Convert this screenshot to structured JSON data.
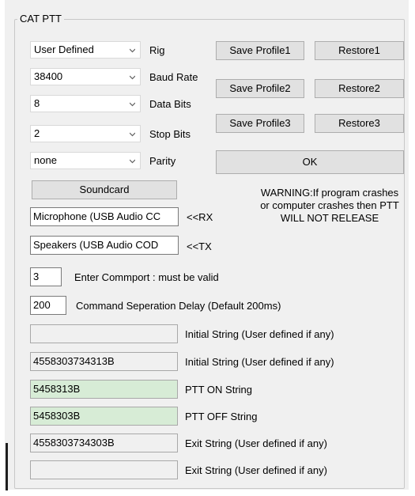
{
  "group": {
    "title": "CAT PTT"
  },
  "serial": {
    "rig": {
      "value": "User Defined",
      "label": "Rig"
    },
    "baud": {
      "value": "38400",
      "label": "Baud Rate"
    },
    "data_bits": {
      "value": "8",
      "label": "Data Bits"
    },
    "stop_bits": {
      "value": "2",
      "label": "Stop Bits"
    },
    "parity": {
      "value": "none",
      "label": "Parity"
    }
  },
  "profiles": {
    "save1": "Save Profile1",
    "restore1": "Restore1",
    "save2": "Save Profile2",
    "restore2": "Restore2",
    "save3": "Save Profile3",
    "restore3": "Restore3",
    "ok": "OK"
  },
  "audio": {
    "soundcard_button": "Soundcard",
    "rx_value": "Microphone (USB Audio CC",
    "rx_label": "<<RX",
    "tx_value": "Speakers (USB Audio COD",
    "tx_label": "<<TX"
  },
  "warning": "WARNING:If program crashes or computer crashes then PTT WILL NOT RELEASE",
  "comport": {
    "value": "3",
    "label": "Enter Commport : must be valid"
  },
  "delay": {
    "value": "200",
    "label": "Command Seperation Delay (Default 200ms)"
  },
  "strings": [
    {
      "value": "",
      "label": "Initial String (User defined if any)"
    },
    {
      "value": "4558303734313B",
      "label": "Initial String (User defined if any)"
    },
    {
      "value": "5458313B",
      "label": "PTT ON String"
    },
    {
      "value": "5458303B",
      "label": "PTT OFF String"
    },
    {
      "value": "4558303734303B",
      "label": "Exit String (User defined if any)"
    },
    {
      "value": "",
      "label": "Exit String (User defined if any)"
    }
  ],
  "colors": {
    "ptt_field": "#d7ecd6",
    "button_face": "#e1e1e1",
    "panel": "#f0f0f0"
  },
  "icons": {
    "combo_arrow": "chevron-down-icon"
  }
}
